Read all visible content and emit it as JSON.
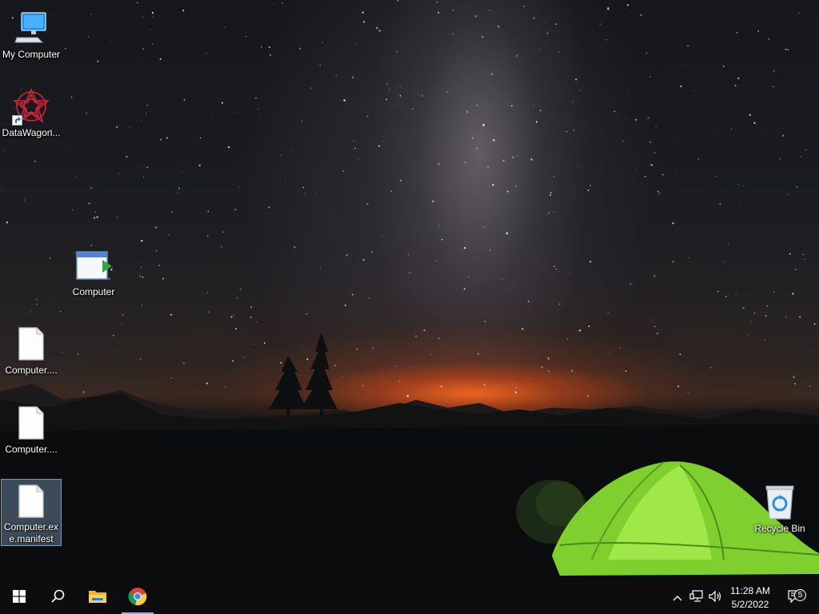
{
  "desktop": {
    "icons": [
      {
        "label": "My Computer",
        "icon": "monitor-icon"
      },
      {
        "label": "DataWagon...",
        "icon": "datawagon-logo-icon",
        "shortcut": true
      },
      {
        "label": "Computer",
        "icon": "application-window-icon"
      },
      {
        "label": "Computer....",
        "icon": "blank-file-icon"
      },
      {
        "label": "Computer....",
        "icon": "blank-file-icon"
      },
      {
        "label": "Computer.exe.manifest",
        "icon": "blank-file-icon",
        "selected": true
      },
      {
        "label": "Recycle Bin",
        "icon": "recycle-bin-icon"
      }
    ]
  },
  "taskbar": {
    "start": "windows-start-icon",
    "search": "search-icon",
    "pinned": [
      {
        "name": "File Explorer",
        "icon": "folder-icon"
      },
      {
        "name": "Google Chrome",
        "icon": "chrome-icon",
        "active": true
      }
    ],
    "tray": {
      "icons": [
        "chevron-up-icon",
        "network-icon",
        "volume-icon"
      ],
      "time": "11:28 AM",
      "date": "5/2/2022",
      "notification_count": "5"
    }
  },
  "colors": {
    "taskbar": "#0d0d0f",
    "active_indicator": "#76b9ed",
    "selection": "#7896b9",
    "tent": "#8ee03a"
  }
}
